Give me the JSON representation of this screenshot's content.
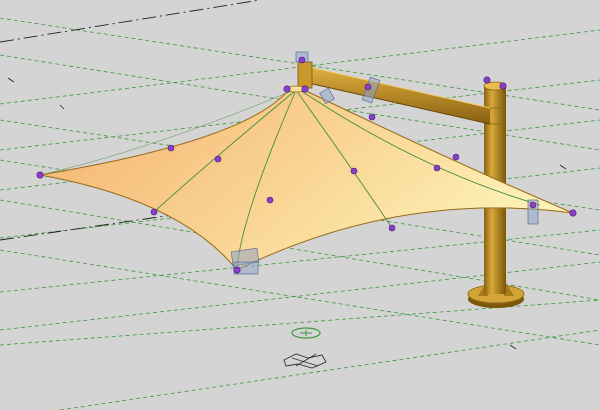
{
  "viewport": {
    "kind": "3d-model-view",
    "background_color": "#d4d4d4",
    "grid_color": "#3a9a3a",
    "reference_line_color": "#222222"
  },
  "model": {
    "element": "tensile-canopy",
    "canopy_fill_light": "#fdf0b4",
    "canopy_fill_dark": "#f4b070",
    "seam_color": "#3f8f3f",
    "edge_color": "#9a7020",
    "frame_color": "#b8861a",
    "frame_dark": "#7a5608",
    "control_point_color": "#8a3fc8",
    "grip_color": "#8fa4c8",
    "control_point_count": 19
  }
}
